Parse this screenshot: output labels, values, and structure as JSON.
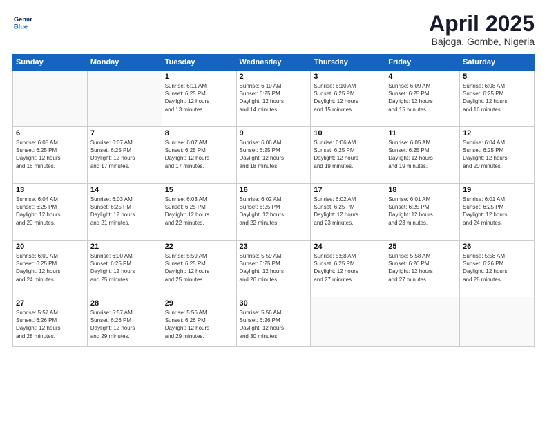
{
  "logo": {
    "line1": "General",
    "line2": "Blue"
  },
  "title": "April 2025",
  "subtitle": "Bajoga, Gombe, Nigeria",
  "weekdays": [
    "Sunday",
    "Monday",
    "Tuesday",
    "Wednesday",
    "Thursday",
    "Friday",
    "Saturday"
  ],
  "weeks": [
    [
      {
        "day": "",
        "info": ""
      },
      {
        "day": "",
        "info": ""
      },
      {
        "day": "1",
        "info": "Sunrise: 6:11 AM\nSunset: 6:25 PM\nDaylight: 12 hours\nand 13 minutes."
      },
      {
        "day": "2",
        "info": "Sunrise: 6:10 AM\nSunset: 6:25 PM\nDaylight: 12 hours\nand 14 minutes."
      },
      {
        "day": "3",
        "info": "Sunrise: 6:10 AM\nSunset: 6:25 PM\nDaylight: 12 hours\nand 15 minutes."
      },
      {
        "day": "4",
        "info": "Sunrise: 6:09 AM\nSunset: 6:25 PM\nDaylight: 12 hours\nand 15 minutes."
      },
      {
        "day": "5",
        "info": "Sunrise: 6:08 AM\nSunset: 6:25 PM\nDaylight: 12 hours\nand 16 minutes."
      }
    ],
    [
      {
        "day": "6",
        "info": "Sunrise: 6:08 AM\nSunset: 6:25 PM\nDaylight: 12 hours\nand 16 minutes."
      },
      {
        "day": "7",
        "info": "Sunrise: 6:07 AM\nSunset: 6:25 PM\nDaylight: 12 hours\nand 17 minutes."
      },
      {
        "day": "8",
        "info": "Sunrise: 6:07 AM\nSunset: 6:25 PM\nDaylight: 12 hours\nand 17 minutes."
      },
      {
        "day": "9",
        "info": "Sunrise: 6:06 AM\nSunset: 6:25 PM\nDaylight: 12 hours\nand 18 minutes."
      },
      {
        "day": "10",
        "info": "Sunrise: 6:06 AM\nSunset: 6:25 PM\nDaylight: 12 hours\nand 19 minutes."
      },
      {
        "day": "11",
        "info": "Sunrise: 6:05 AM\nSunset: 6:25 PM\nDaylight: 12 hours\nand 19 minutes."
      },
      {
        "day": "12",
        "info": "Sunrise: 6:04 AM\nSunset: 6:25 PM\nDaylight: 12 hours\nand 20 minutes."
      }
    ],
    [
      {
        "day": "13",
        "info": "Sunrise: 6:04 AM\nSunset: 6:25 PM\nDaylight: 12 hours\nand 20 minutes."
      },
      {
        "day": "14",
        "info": "Sunrise: 6:03 AM\nSunset: 6:25 PM\nDaylight: 12 hours\nand 21 minutes."
      },
      {
        "day": "15",
        "info": "Sunrise: 6:03 AM\nSunset: 6:25 PM\nDaylight: 12 hours\nand 22 minutes."
      },
      {
        "day": "16",
        "info": "Sunrise: 6:02 AM\nSunset: 6:25 PM\nDaylight: 12 hours\nand 22 minutes."
      },
      {
        "day": "17",
        "info": "Sunrise: 6:02 AM\nSunset: 6:25 PM\nDaylight: 12 hours\nand 23 minutes."
      },
      {
        "day": "18",
        "info": "Sunrise: 6:01 AM\nSunset: 6:25 PM\nDaylight: 12 hours\nand 23 minutes."
      },
      {
        "day": "19",
        "info": "Sunrise: 6:01 AM\nSunset: 6:25 PM\nDaylight: 12 hours\nand 24 minutes."
      }
    ],
    [
      {
        "day": "20",
        "info": "Sunrise: 6:00 AM\nSunset: 6:25 PM\nDaylight: 12 hours\nand 24 minutes."
      },
      {
        "day": "21",
        "info": "Sunrise: 6:00 AM\nSunset: 6:25 PM\nDaylight: 12 hours\nand 25 minutes."
      },
      {
        "day": "22",
        "info": "Sunrise: 5:59 AM\nSunset: 6:25 PM\nDaylight: 12 hours\nand 25 minutes."
      },
      {
        "day": "23",
        "info": "Sunrise: 5:59 AM\nSunset: 6:25 PM\nDaylight: 12 hours\nand 26 minutes."
      },
      {
        "day": "24",
        "info": "Sunrise: 5:58 AM\nSunset: 6:25 PM\nDaylight: 12 hours\nand 27 minutes."
      },
      {
        "day": "25",
        "info": "Sunrise: 5:58 AM\nSunset: 6:26 PM\nDaylight: 12 hours\nand 27 minutes."
      },
      {
        "day": "26",
        "info": "Sunrise: 5:58 AM\nSunset: 6:26 PM\nDaylight: 12 hours\nand 28 minutes."
      }
    ],
    [
      {
        "day": "27",
        "info": "Sunrise: 5:57 AM\nSunset: 6:26 PM\nDaylight: 12 hours\nand 28 minutes."
      },
      {
        "day": "28",
        "info": "Sunrise: 5:57 AM\nSunset: 6:26 PM\nDaylight: 12 hours\nand 29 minutes."
      },
      {
        "day": "29",
        "info": "Sunrise: 5:56 AM\nSunset: 6:26 PM\nDaylight: 12 hours\nand 29 minutes."
      },
      {
        "day": "30",
        "info": "Sunrise: 5:56 AM\nSunset: 6:26 PM\nDaylight: 12 hours\nand 30 minutes."
      },
      {
        "day": "",
        "info": ""
      },
      {
        "day": "",
        "info": ""
      },
      {
        "day": "",
        "info": ""
      }
    ]
  ]
}
